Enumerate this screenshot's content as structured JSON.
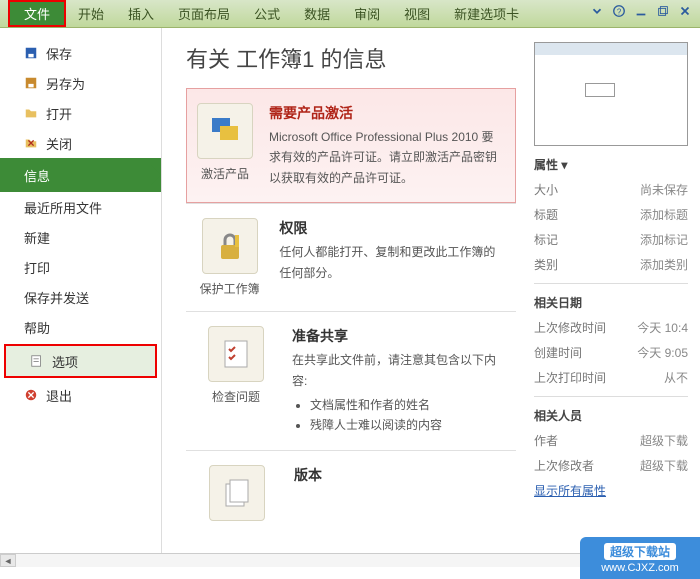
{
  "ribbon": {
    "tabs": [
      "文件",
      "开始",
      "插入",
      "页面布局",
      "公式",
      "数据",
      "审阅",
      "视图",
      "新建选项卡"
    ]
  },
  "sidebar": {
    "save": "保存",
    "save_as": "另存为",
    "open": "打开",
    "close": "关闭",
    "info": "信息",
    "recent": "最近所用文件",
    "new": "新建",
    "print": "打印",
    "share": "保存并发送",
    "help": "帮助",
    "options": "选项",
    "exit": "退出"
  },
  "main": {
    "title": "有关 工作簿1 的信息",
    "activate": {
      "btn": "激活产品",
      "heading": "需要产品激活",
      "body": "Microsoft Office Professional Plus 2010 要求有效的产品许可证。请立即激活产品密钥以获取有效的产品许可证。"
    },
    "permissions": {
      "btn": "保护工作簿",
      "heading": "权限",
      "body": "任何人都能打开、复制和更改此工作簿的任何部分。"
    },
    "inspect": {
      "btn": "检查问题",
      "heading": "准备共享",
      "body": "在共享此文件前，请注意其包含以下内容:",
      "li1": "文档属性和作者的姓名",
      "li2": "残障人士难以阅读的内容"
    },
    "versions": {
      "heading": "版本"
    }
  },
  "rpanel": {
    "props_heading": "属性",
    "size_k": "大小",
    "size_v": "尚未保存",
    "title_k": "标题",
    "title_v": "添加标题",
    "tags_k": "标记",
    "tags_v": "添加标记",
    "cat_k": "类别",
    "cat_v": "添加类别",
    "dates_heading": "相关日期",
    "modified_k": "上次修改时间",
    "modified_v": "今天 10:4",
    "created_k": "创建时间",
    "created_v": "今天 9:05",
    "printed_k": "上次打印时间",
    "printed_v": "从不",
    "people_heading": "相关人员",
    "author_k": "作者",
    "author_v": "超级下载",
    "lastmod_k": "上次修改者",
    "lastmod_v": "超级下载",
    "showall": "显示所有属性"
  },
  "watermark": {
    "l1": "超级下载站",
    "l2": "www.CJXZ.com"
  }
}
